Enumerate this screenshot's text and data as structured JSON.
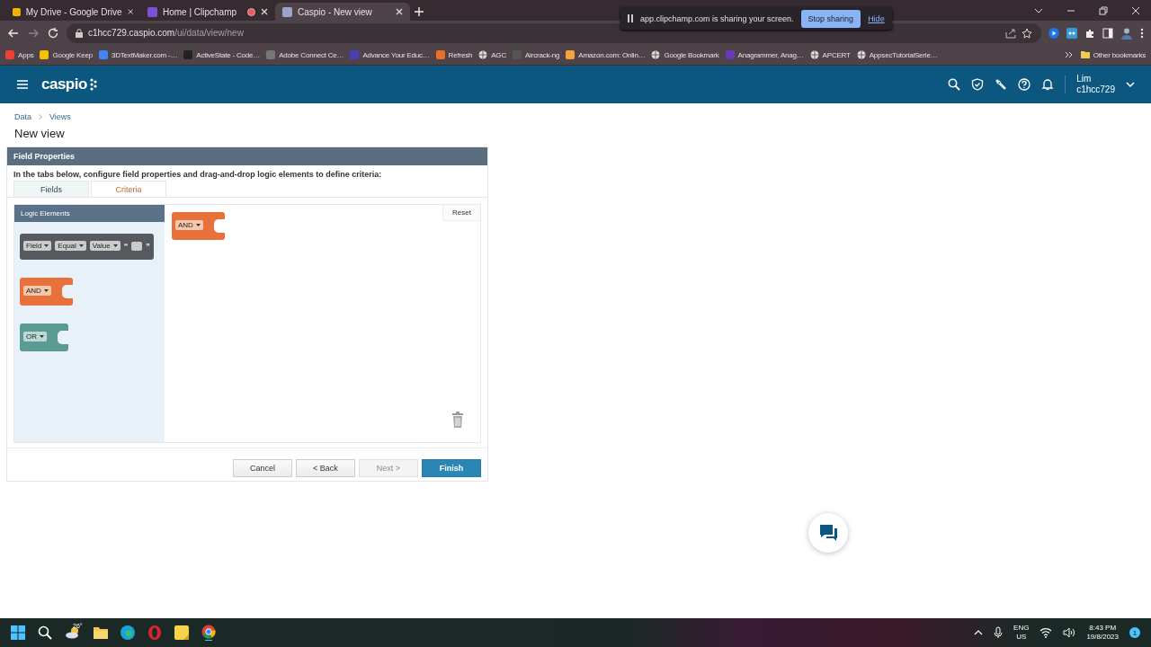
{
  "browser": {
    "tabs": [
      {
        "title": "My Drive - Google Drive",
        "selected": false,
        "recording": false
      },
      {
        "title": "Home | Clipchamp",
        "selected": false,
        "recording": true
      },
      {
        "title": "Caspio - New view",
        "selected": true,
        "recording": false
      }
    ],
    "address": {
      "host": "c1hcc729.caspio.com",
      "path": "/ui/data/view/new"
    },
    "sharing_bar": {
      "message": "app.clipchamp.com is sharing your screen.",
      "stop_button": "Stop sharing",
      "hide_link": "Hide"
    },
    "bookmarks": [
      "Apps",
      "Google Keep",
      "3DTextMaker.com -…",
      "ActiveState - Code…",
      "Adobe Connect Ce…",
      "Advance Your Educ…",
      "Refresh",
      "AGC",
      "Aircrack-ng",
      "Amazon.com: Onlin…",
      "Google Bookmark",
      "Anagrammer, Anag…",
      "APCERT",
      "AppsecTutorialSerie…"
    ],
    "other_bookmarks": "Other bookmarks"
  },
  "app": {
    "logo": "caspio",
    "user": {
      "name": "Lim",
      "account": "c1hcc729"
    }
  },
  "breadcrumb": [
    "Data",
    "Views"
  ],
  "page_title": "New view",
  "panel": {
    "title": "Field Properties",
    "instruction": "In the tabs below, configure field properties and drag-and-drop logic elements to define criteria:",
    "tabs": [
      {
        "label": "Fields",
        "selected": false
      },
      {
        "label": "Criteria",
        "selected": true
      }
    ],
    "palette": {
      "title": "Logic Elements",
      "blocks": [
        {
          "kind": "comparison",
          "dropdowns": [
            "Field",
            "Equal",
            "Value"
          ],
          "quotes": [
            "“",
            "”"
          ]
        },
        {
          "kind": "and",
          "dropdowns": [
            "AND"
          ]
        },
        {
          "kind": "or",
          "dropdowns": [
            "OR"
          ]
        }
      ]
    },
    "workspace": {
      "reset": "Reset",
      "blocks": [
        {
          "kind": "and",
          "dropdowns": [
            "AND"
          ]
        }
      ]
    },
    "buttons": [
      {
        "label": "Cancel",
        "kind": "default",
        "disabled": false
      },
      {
        "label": "< Back",
        "kind": "default",
        "disabled": false
      },
      {
        "label": "Next >",
        "kind": "default",
        "disabled": true
      },
      {
        "label": "Finish",
        "kind": "primary",
        "disabled": false
      }
    ]
  },
  "taskbar": {
    "weather": "26°",
    "language": [
      "ENG",
      "US"
    ],
    "time": "8:43 PM",
    "date": "19/8/2023",
    "notifications": "1"
  }
}
